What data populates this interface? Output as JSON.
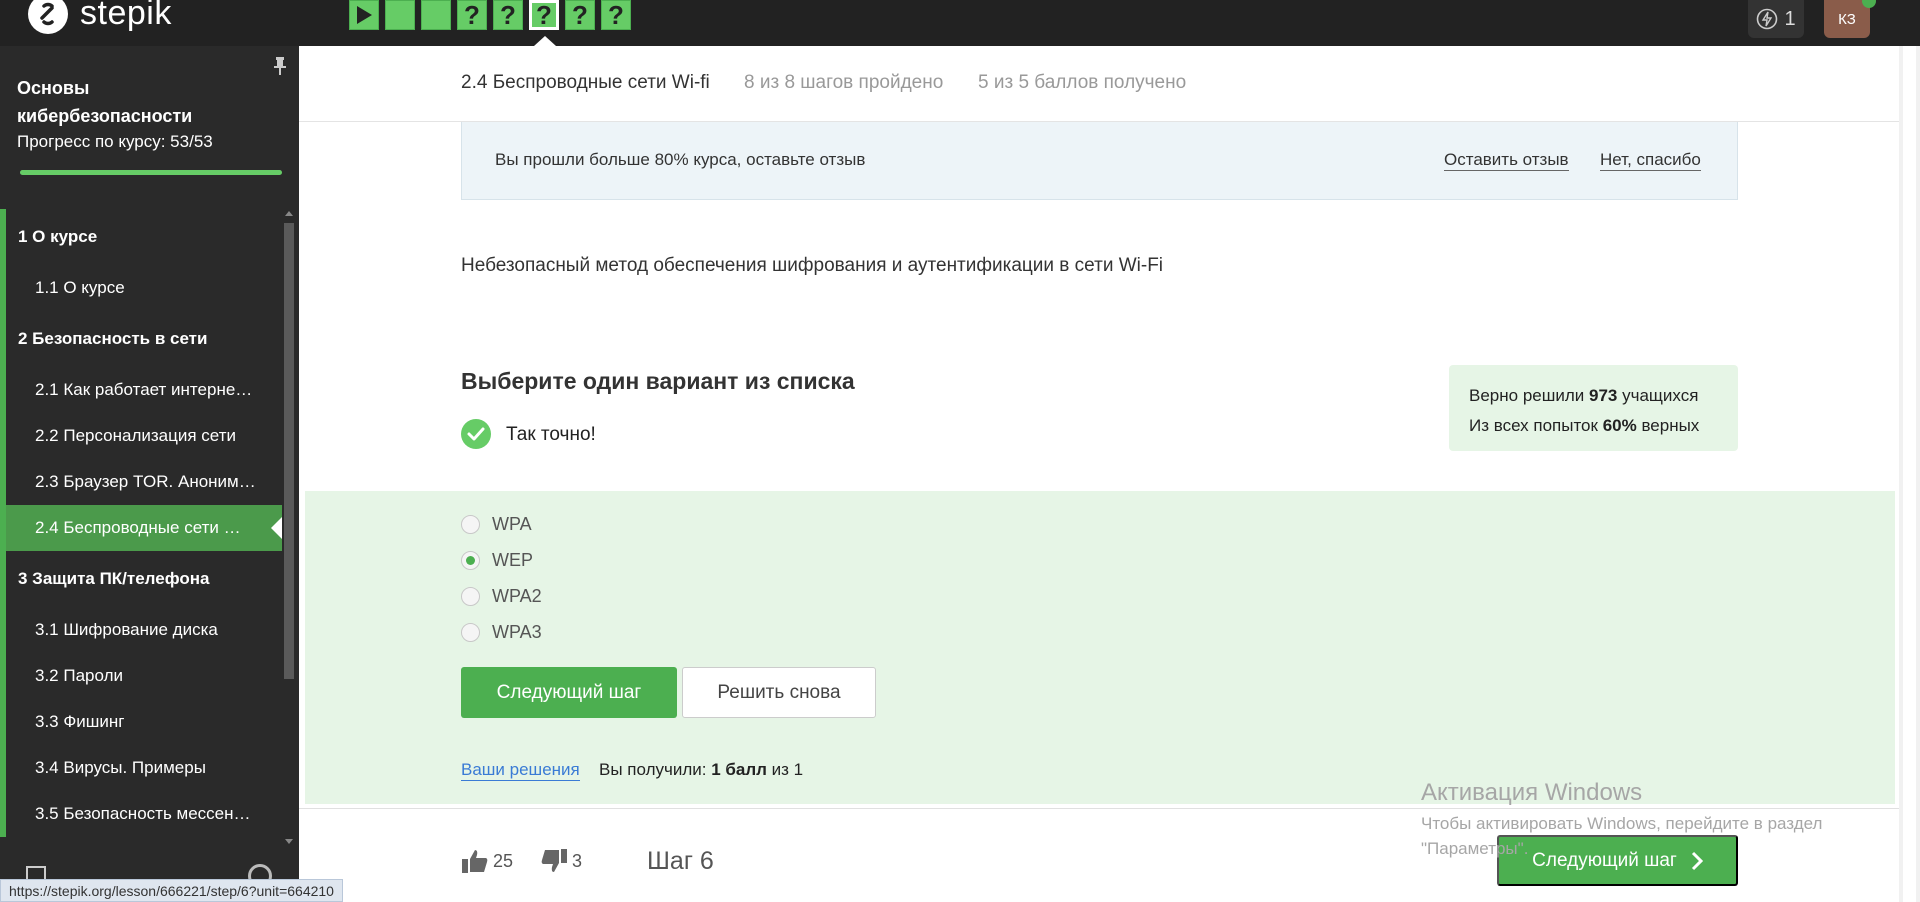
{
  "topbar": {
    "logo_text": "stepik",
    "steps": [
      "",
      "",
      "",
      "?",
      "?",
      "?",
      "?",
      "?"
    ],
    "active_step_index": 5,
    "energy_count": "1",
    "avatar_initials": "КЗ"
  },
  "sidebar": {
    "course_title": "Основы кибербезопасности",
    "progress_label": "Прогресс по курсу:  53/53",
    "progress_fraction": 1.0,
    "sections": [
      {
        "title": "1  О курсе",
        "items": [
          {
            "label": "1.1  О курсе"
          }
        ]
      },
      {
        "title": "2  Безопасность в сети",
        "items": [
          {
            "label": "2.1  Как работает интерне…"
          },
          {
            "label": "2.2  Персонализация сети"
          },
          {
            "label": "2.3  Браузер TOR. Аноним…"
          },
          {
            "label": "2.4  Беспроводные сети …",
            "active": true
          }
        ]
      },
      {
        "title": "3  Защита ПК/телефона",
        "items": [
          {
            "label": "3.1  Шифрование диска"
          },
          {
            "label": "3.2  Пароли"
          },
          {
            "label": "3.3  Фишинг"
          },
          {
            "label": "3.4  Вирусы. Примеры"
          },
          {
            "label": "3.5  Безопасность мессен…"
          }
        ]
      }
    ]
  },
  "lesson": {
    "title": "2.4 Беспроводные сети Wi-fi",
    "steps_done": "8 из 8 шагов пройдено",
    "score": "5 из 5 баллов  получено"
  },
  "review": {
    "text": "Вы прошли больше 80% курса, оставьте отзыв",
    "leave_review": "Оставить отзыв",
    "no_thanks": "Нет, спасибо"
  },
  "question": {
    "text": "Небезопасный метод обеспечения шифрования и аутентификации в сети Wi-Fi",
    "choose_title": "Выберите один вариант из списка",
    "result_text": "Так точно!",
    "options": [
      {
        "label": "WPA",
        "selected": false
      },
      {
        "label": "WEP",
        "selected": true
      },
      {
        "label": "WPA2",
        "selected": false
      },
      {
        "label": "WPA3",
        "selected": false
      }
    ]
  },
  "stats": {
    "solved_prefix": "Верно решили ",
    "solved_count": "973",
    "solved_suffix": " учащихся",
    "attempts_prefix": "Из всех попыток ",
    "attempts_pct": "60%",
    "attempts_suffix": " верных"
  },
  "actions": {
    "next_step": "Следующий шаг",
    "solve_again": "Решить снова",
    "your_solutions": "Ваши решения",
    "score_prefix": "Вы получили: ",
    "score_value": "1 балл",
    "score_suffix": " из 1"
  },
  "footer": {
    "likes": "25",
    "dislikes": "3",
    "step_label": "Шаг 6",
    "next_step": "Следующий шаг"
  },
  "windows_watermark": {
    "title": "Активация Windows",
    "subtitle": "Чтобы активировать Windows, перейдите в раздел \"Параметры\"."
  },
  "status_url": "https://stepik.org/lesson/666221/step/6?unit=664210",
  "colors": {
    "brand_green": "#4caf50",
    "step_green": "#66cc66",
    "sidebar_bg": "#2a2a2a",
    "topbar_bg": "#222222",
    "answer_bg": "#e6f5e6"
  }
}
